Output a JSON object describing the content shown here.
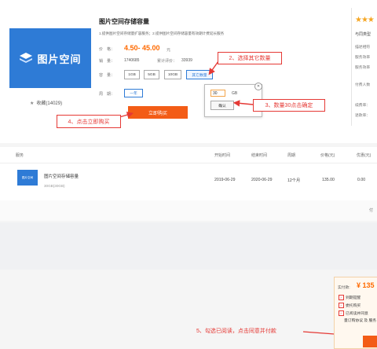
{
  "product": {
    "logo_text": "图片空间",
    "favorites": "收藏(14029)",
    "title": "图片空间存储容量",
    "description": "1.提供图片空间存储量扩容服务；2.提供图片空间存储容量有效期计费延长服务",
    "price_label": "价　格：",
    "price": "4.50- 45.00",
    "price_unit": "元",
    "sales_label": "销　量：",
    "sales": "1740685",
    "rating_label": "累计评价：",
    "rating": "33939",
    "capacity_label": "容　量：",
    "capacity_options": [
      "1GB",
      "5GB",
      "10GB",
      "其它数量"
    ],
    "selected_capacity": "其它数量",
    "cycle_label": "周　期：",
    "cycle_option": "一年",
    "buy_button": "立即购买"
  },
  "popup": {
    "qty_value": "30",
    "qty_unit": "GB",
    "confirm": "确认"
  },
  "right_panel": {
    "stars": "★★★",
    "same_class": "与同类型",
    "rows": [
      "描述相符",
      "服务效率",
      "服务效率",
      "付费人数",
      "续费率：",
      "退款率："
    ]
  },
  "annotations": {
    "step2": "2、选择其它数量",
    "step3": "3、数量30点击确定",
    "step4": "4、点击立即购买",
    "step5": "5、勾选已阅读，点击同意并付款"
  },
  "table": {
    "headers": [
      "服务",
      "开始时间",
      "结束时间",
      "周期",
      "价格(元)",
      "优惠(元)"
    ],
    "row": {
      "logo_text": "图片空间",
      "name": "图片空间存储容量",
      "spec": "30GB(30GB)",
      "start": "2019-06-29",
      "end": "2020-06-29",
      "period": "12个月",
      "price": "135.00",
      "discount": "0.00"
    },
    "section2_text": "付"
  },
  "payment": {
    "label": "实付款:",
    "amount": "¥ 135",
    "options": [
      "到期提醒",
      "委托购买",
      "已阅读并同意"
    ],
    "agreement": "量订购协议 及 服务"
  },
  "colors": {
    "accent": "#f35c16",
    "brand_blue": "#2e7bd6",
    "annotation_red": "#e53935",
    "price_orange": "#ff6a00"
  }
}
